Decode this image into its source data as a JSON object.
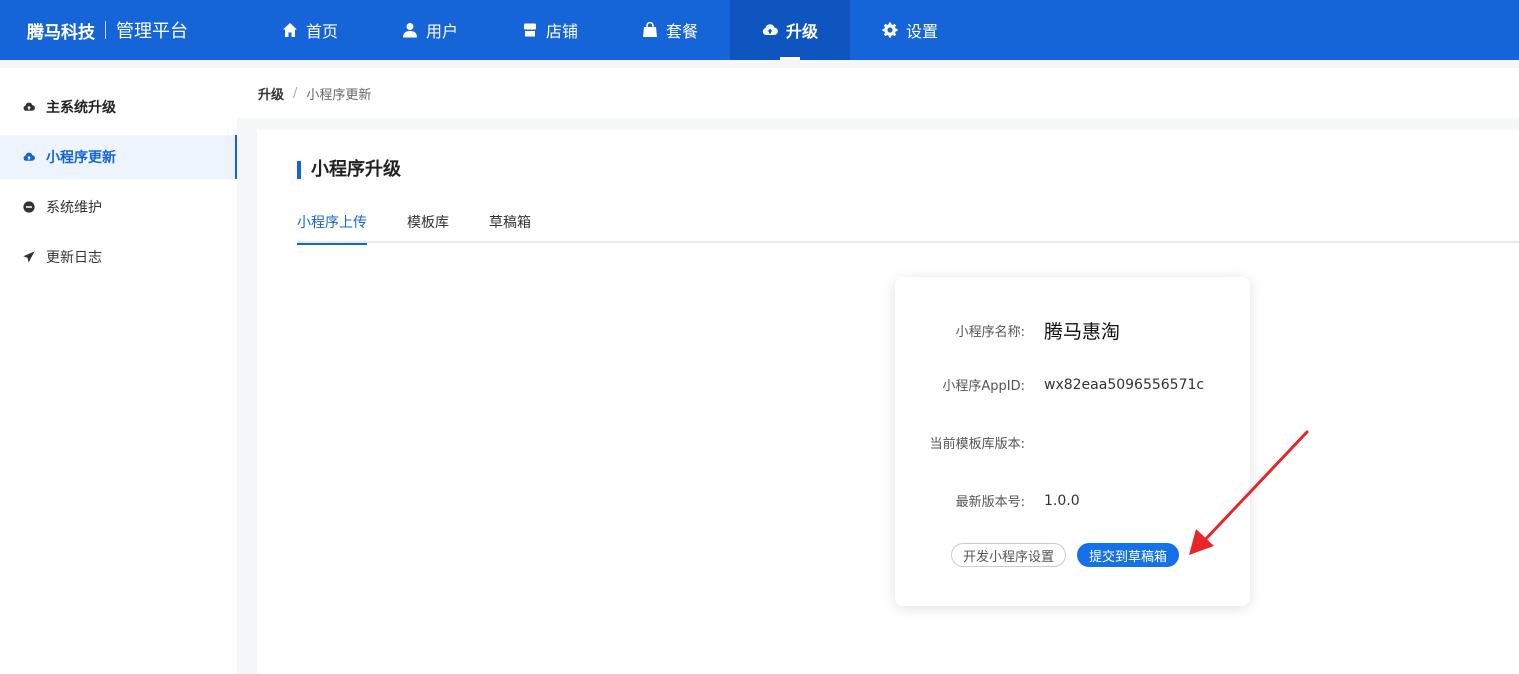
{
  "brand": {
    "logo": "腾马科技",
    "subtitle": "管理平台"
  },
  "nav": [
    {
      "label": "首页",
      "icon": "home-icon"
    },
    {
      "label": "用户",
      "icon": "user-icon"
    },
    {
      "label": "店铺",
      "icon": "store-icon"
    },
    {
      "label": "套餐",
      "icon": "bag-icon"
    },
    {
      "label": "升级",
      "icon": "cloud-upload-icon",
      "active": true
    },
    {
      "label": "设置",
      "icon": "gear-icon"
    }
  ],
  "sidebar": {
    "items": [
      {
        "label": "主系统升级",
        "icon": "cloud-upload-icon"
      },
      {
        "label": "小程序更新",
        "icon": "cloud-upload-icon",
        "active": true
      },
      {
        "label": "系统维护",
        "icon": "minus-circle-icon"
      },
      {
        "label": "更新日志",
        "icon": "send-icon"
      }
    ]
  },
  "breadcrumb": {
    "root": "升级",
    "sep": "/",
    "current": "小程序更新"
  },
  "section": {
    "title": "小程序升级"
  },
  "tabs": [
    {
      "label": "小程序上传",
      "active": true
    },
    {
      "label": "模板库"
    },
    {
      "label": "草稿箱"
    }
  ],
  "card": {
    "name_label": "小程序名称:",
    "name_value": "腾马惠淘",
    "appid_label": "小程序AppID:",
    "appid_value": "wx82eaa5096556571c",
    "template_label": "当前模板库版本:",
    "template_value": "",
    "latest_label": "最新版本号:",
    "latest_value": "1.0.0",
    "btn_settings": "开发小程序设置",
    "btn_submit": "提交到草稿箱"
  },
  "colors": {
    "primary": "#1565d8",
    "annotation": "#e8262a"
  }
}
